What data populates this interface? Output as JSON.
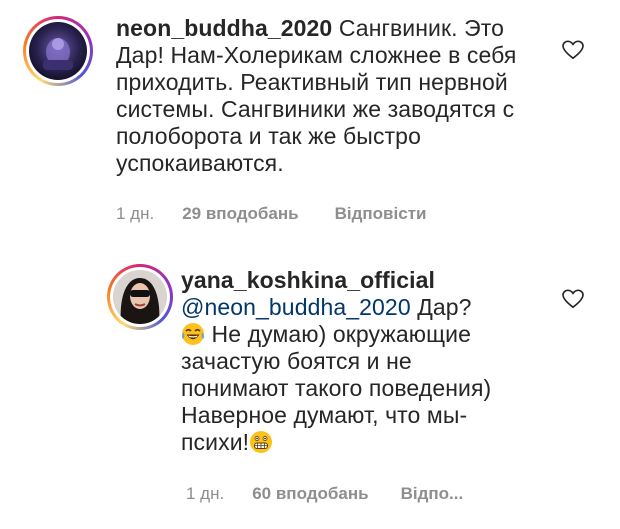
{
  "comment1": {
    "username": "neon_buddha_2020",
    "text": "Сангвиник. Это Дар! Нам-Холерикам сложнее в себя приходить. Реактивный тип нервной системы. Сангвиники же заводятся с полоборота и так же быстро успокаиваются.",
    "time": "1 дн.",
    "likes": "29 вподобань",
    "reply_label": "Відповісти",
    "avatar_icon": "avatar-dark-purple"
  },
  "comment2": {
    "username": "yana_koshkina_official",
    "mention": "@neon_buddha_2020",
    "text_after_mention": " Дар?",
    "line2": " Не думаю) окружающие зачастую боятся и не понимают такого поведения) Наверное думают, что мы-психи!",
    "emoji1": "face-with-tears-of-joy",
    "emoji2": "grimacing-face",
    "time": "1 дн.",
    "likes": "60 вподобань",
    "reply_label": "Відпо...",
    "avatar_icon": "avatar-woman"
  },
  "colors": {
    "text": "#262626",
    "secondary": "#8e8e8e",
    "mention": "#00376b"
  }
}
